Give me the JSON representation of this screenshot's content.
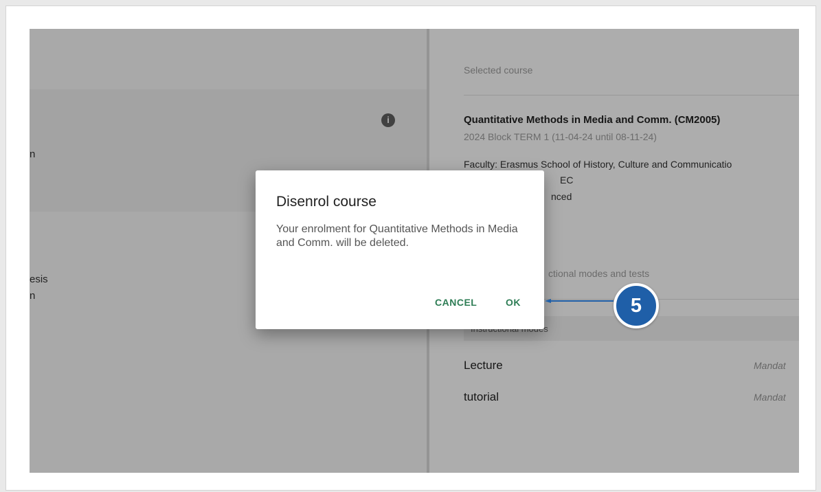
{
  "left_panel": {
    "fragments": [
      "n",
      "esis",
      "n"
    ]
  },
  "right_panel": {
    "section_label": "Selected course",
    "course_title": "Quantitative Methods in Media and Comm. (CM2005)",
    "course_term": "2024 Block TERM 1 (11-04-24 until 08-11-24)",
    "faculty": "Faculty: Erasmus School of History, Culture and Communicatio",
    "credits_fragment": "EC",
    "level_fragment": "nced",
    "modes_tests_fragment": "ctional modes and tests",
    "modes_header": "Instructional modes",
    "modes": [
      {
        "name": "Lecture",
        "status": "Mandat"
      },
      {
        "name": "tutorial",
        "status": "Mandat"
      }
    ]
  },
  "dialog": {
    "title": "Disenrol course",
    "message": "Your enrolment for Quantitative Methods in Media and Comm. will be deleted.",
    "cancel_label": "CANCEL",
    "ok_label": "OK"
  },
  "callout": {
    "number": "5",
    "color": "#1f5fa8"
  },
  "icons": {
    "info": "info-icon"
  }
}
